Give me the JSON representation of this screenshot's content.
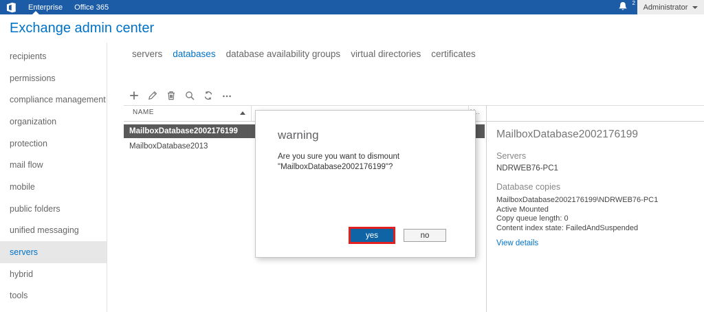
{
  "topbar": {
    "tabs": [
      {
        "label": "Enterprise",
        "active": true
      },
      {
        "label": "Office 365",
        "active": false
      }
    ],
    "notification_count": "2",
    "user_menu_label": "Administrator"
  },
  "header": {
    "title": "Exchange admin center"
  },
  "sidebar": {
    "items": [
      {
        "label": "recipients",
        "selected": false
      },
      {
        "label": "permissions",
        "selected": false
      },
      {
        "label": "compliance management",
        "selected": false
      },
      {
        "label": "organization",
        "selected": false
      },
      {
        "label": "protection",
        "selected": false
      },
      {
        "label": "mail flow",
        "selected": false
      },
      {
        "label": "mobile",
        "selected": false
      },
      {
        "label": "public folders",
        "selected": false
      },
      {
        "label": "unified messaging",
        "selected": false
      },
      {
        "label": "servers",
        "selected": true
      },
      {
        "label": "hybrid",
        "selected": false
      },
      {
        "label": "tools",
        "selected": false
      }
    ]
  },
  "content_tabs": [
    {
      "label": "servers",
      "active": false
    },
    {
      "label": "databases",
      "active": true
    },
    {
      "label": "database availability groups",
      "active": false
    },
    {
      "label": "virtual directories",
      "active": false
    },
    {
      "label": "certificates",
      "active": false
    }
  ],
  "toolbar": {
    "icons": [
      "add-icon",
      "edit-icon",
      "delete-icon",
      "search-icon",
      "refresh-icon",
      "more-icon"
    ]
  },
  "table": {
    "columns": [
      {
        "label": "NAME",
        "sort": "asc"
      },
      {
        "label": "Y..."
      }
    ],
    "rows": [
      {
        "name": "MailboxDatabase2002176199",
        "selected": true
      },
      {
        "name": "MailboxDatabase2013",
        "selected": false
      }
    ]
  },
  "dialog": {
    "title": "warning",
    "message_line1": "Are you sure you want to dismount",
    "message_line2": "\"MailboxDatabase2002176199\"?",
    "yes_label": "yes",
    "no_label": "no"
  },
  "details": {
    "title": "MailboxDatabase2002176199",
    "servers_heading": "Servers",
    "server_name": "NDRWEB76-PC1",
    "copies_heading": "Database copies",
    "copy_lines": [
      "MailboxDatabase2002176199\\NDRWEB76-PC1",
      "Active Mounted",
      "Copy queue length: 0",
      "Content index state: FailedAndSuspended"
    ],
    "link_label": "View details"
  },
  "colors": {
    "topbar_blue": "#1c5ca6",
    "accent_blue": "#0072c6",
    "yes_button_blue": "#0f64a5",
    "highlight_red": "#e32020",
    "selected_row_gray": "#595959",
    "admin_strip_gray": "#ededed"
  }
}
